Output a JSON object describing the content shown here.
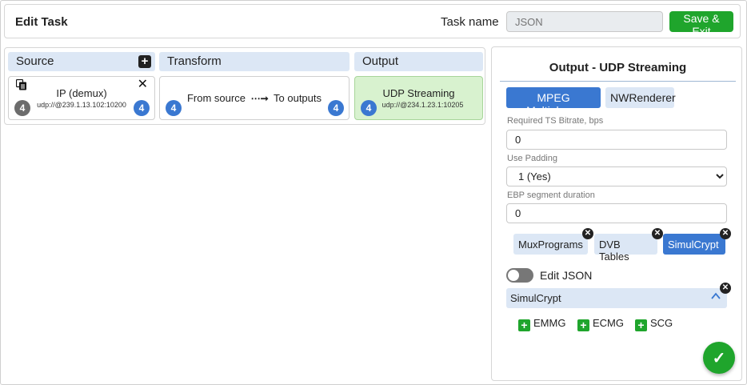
{
  "header": {
    "title": "Edit Task",
    "task_name_label": "Task name",
    "task_name_placeholder": "JSON",
    "save_label": "Save & Exit"
  },
  "pipeline": {
    "source": {
      "heading": "Source",
      "card": {
        "name": "IP (demux)",
        "address": "udp://@239.1.13.102:10200",
        "left_count": "4",
        "right_count": "4"
      }
    },
    "transform": {
      "heading": "Transform",
      "card": {
        "from": "From source",
        "to": "To outputs",
        "left_count": "4",
        "right_count": "4"
      }
    },
    "output": {
      "heading": "Output",
      "card": {
        "name": "UDP Streaming",
        "address": "udp://@234.1.23.1:10205",
        "left_count": "4"
      }
    }
  },
  "panel": {
    "title": "Output - UDP Streaming",
    "tabs": [
      "MPEG Multiplexer",
      "NWRenderer"
    ],
    "fields": {
      "bitrate_label": "Required TS Bitrate, bps",
      "bitrate_value": "0",
      "padding_label": "Use Padding",
      "padding_value": "1 (Yes)",
      "ebp_label": "EBP segment duration",
      "ebp_value": "0"
    },
    "chips": [
      "MuxPrograms",
      "DVB Tables",
      "SimulCrypt"
    ],
    "edit_json_label": "Edit JSON",
    "accordion_title": "SimulCrypt",
    "add_items": [
      "EMMG",
      "ECMG",
      "SCG"
    ],
    "ok_symbol": "✓"
  },
  "colors": {
    "accent_blue": "#3a78d1",
    "light_blue": "#dce7f5",
    "green": "#1fa52c",
    "output_card_bg": "#d8f2cf"
  }
}
